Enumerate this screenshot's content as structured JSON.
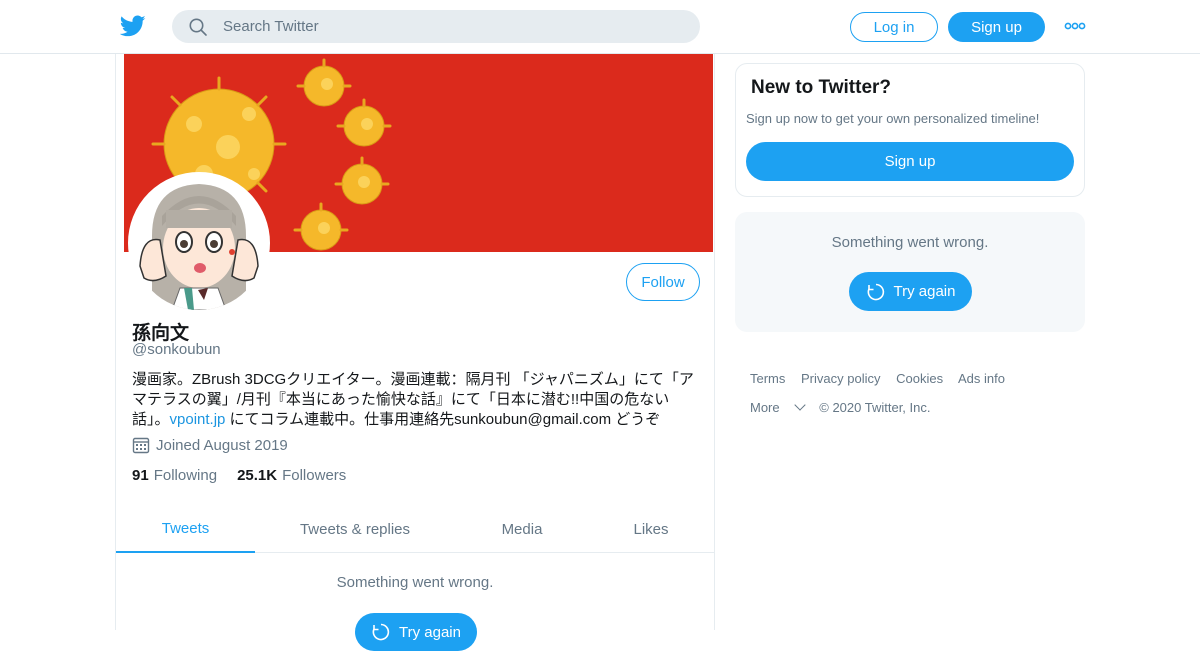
{
  "header": {
    "search_placeholder": "Search Twitter",
    "login_label": "Log in",
    "signup_label": "Sign up",
    "brand_color": "#1da1f2"
  },
  "profile": {
    "name": "孫向文",
    "handle": "@sonkoubun",
    "follow_label": "Follow",
    "bio_part1": "漫画家。ZBrush 3DCGクリエイター。漫画連載：隔月刊 「ジャパニズム」にて「アマテラスの翼」/月刊『本当にあった愉快な話』にて「日本に潜む!!中国の危ない話」。",
    "bio_link": "vpoint.jp",
    "bio_part2": " にてコラム連載中。仕事用連絡先sunkoubun@gmail.com どうぞ",
    "joined": "Joined August 2019",
    "following_count": "91",
    "following_label": "Following",
    "followers_count": "25.1K",
    "followers_label": "Followers",
    "banner_color": "#db2a1c"
  },
  "tabs": [
    {
      "label": "Tweets"
    },
    {
      "label": "Tweets & replies"
    },
    {
      "label": "Media"
    },
    {
      "label": "Likes"
    }
  ],
  "timeline": {
    "error": "Something went wrong.",
    "retry_label": "Try again"
  },
  "sidebar": {
    "new_title": "New to Twitter?",
    "new_sub": "Sign up now to get your own personalized timeline!",
    "signup_label": "Sign up",
    "error": "Something went wrong.",
    "retry_label": "Try again"
  },
  "footer": {
    "terms": "Terms",
    "privacy": "Privacy policy",
    "cookies": "Cookies",
    "ads": "Ads info",
    "more": "More",
    "copyright": "© 2020 Twitter, Inc."
  }
}
